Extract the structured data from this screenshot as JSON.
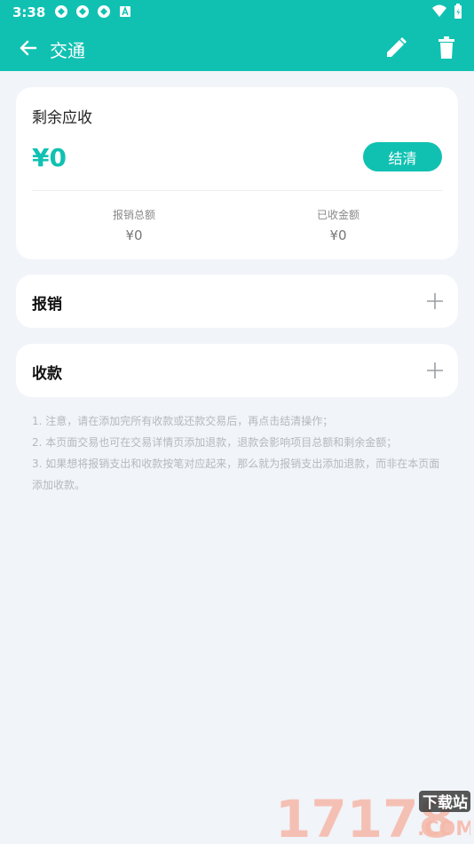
{
  "status": {
    "time": "3:38"
  },
  "appbar": {
    "title": "交通"
  },
  "summary": {
    "label": "剩余应收",
    "amount": "¥0",
    "settle_label": "结清",
    "stats": [
      {
        "label": "报销总额",
        "value": "¥0"
      },
      {
        "label": "已收金额",
        "value": "¥0"
      }
    ]
  },
  "sections": {
    "reimburse": "报销",
    "collect": "收款"
  },
  "notes": [
    "1. 注意，请在添加完所有收款或还款交易后，再点击结清操作；",
    "2. 本页面交易也可在交易详情页添加退款，退款会影响项目总额和剩余金额；",
    "3. 如果想将报销支出和收款按笔对应起来，那么就为报销支出添加退款，而非在本页面添加收款。"
  ],
  "watermark": {
    "number": "17178",
    "text_top": "下载站",
    "text_bottom": ".COM"
  },
  "colors": {
    "accent": "#10c1b2",
    "background": "#f1f4f9"
  }
}
